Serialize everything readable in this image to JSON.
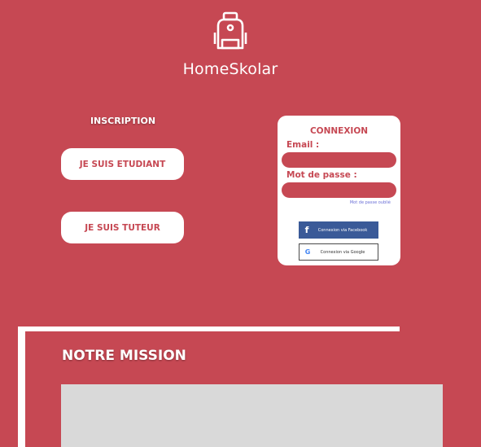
{
  "colors": {
    "background": "#c64853",
    "accent": "#c64853",
    "facebook": "#3a5a98",
    "mission_box": "#d9d9d9"
  },
  "header": {
    "brand": "HomeSkolar",
    "logo_icon": "backpack-icon"
  },
  "inscription": {
    "title": "INSCRIPTION",
    "student_label": "JE SUIS ETUDIANT",
    "tutor_label": "JE SUIS TUTEUR"
  },
  "login": {
    "title": "CONNEXION",
    "email_label": "Email :",
    "email_value": "",
    "password_label": "Mot de passe :",
    "password_value": "",
    "forgot_label": "Mot de passe oublié",
    "facebook_label": "Connexion via Facebook",
    "facebook_icon": "facebook-icon",
    "google_label": "Connexion via Google",
    "google_icon": "google-icon"
  },
  "mission": {
    "title": "NOTRE MISSION"
  }
}
